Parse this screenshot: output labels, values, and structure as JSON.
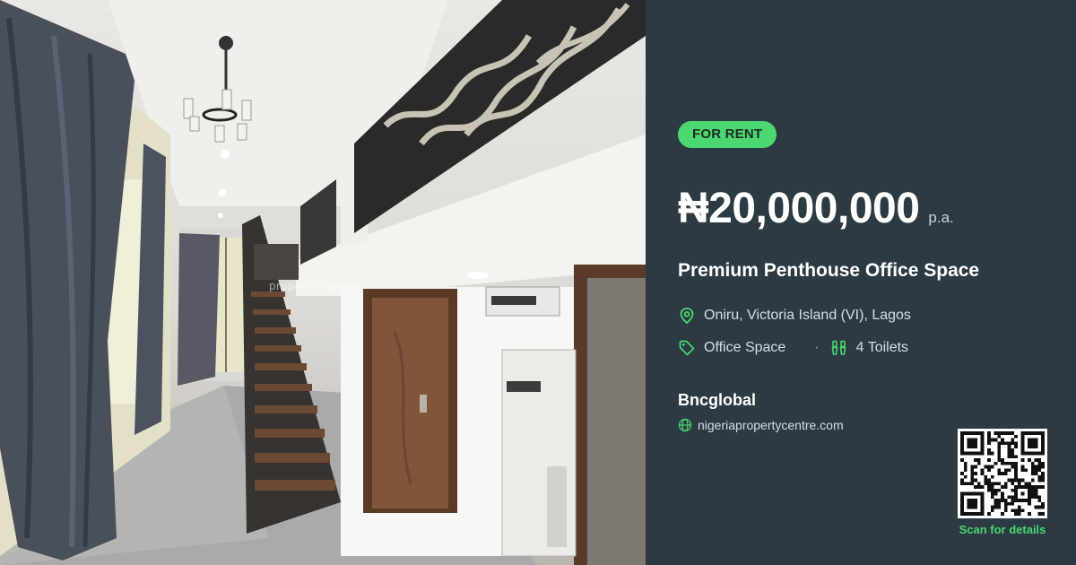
{
  "photo": {
    "watermark": "property centre"
  },
  "listing": {
    "badge": "FOR RENT",
    "price": "₦20,000,000",
    "period": "p.a.",
    "title": "Premium Penthouse Office Space",
    "location": "Oniru, Victoria Island (VI), Lagos",
    "property_type": "Office Space",
    "separator": "·",
    "toilets": "4 Toilets"
  },
  "agent": {
    "name": "Bncglobal",
    "website": "nigeriapropertycentre.com"
  },
  "qr": {
    "caption": "Scan for details"
  },
  "colors": {
    "panel_bg": "#2c3a44",
    "accent": "#4cd771",
    "text": "#ffffff",
    "muted": "#d7dee3"
  },
  "icons": {
    "location": "map-pin-icon",
    "type": "tag-icon",
    "toilets": "toilet-icon",
    "website": "globe-icon"
  }
}
